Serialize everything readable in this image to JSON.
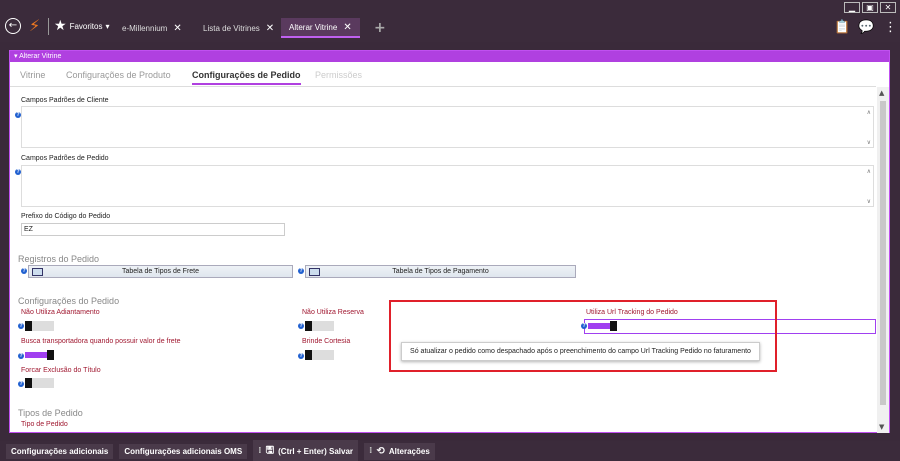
{
  "window": {
    "controls": [
      "▁",
      "▣",
      "✕"
    ]
  },
  "header": {
    "favorites_label": "Favoritos",
    "favorites_caret": "▾",
    "tabs": [
      {
        "label": "e-Millennium",
        "active": false
      },
      {
        "label": "Lista de Vitrines",
        "active": false
      },
      {
        "label": "Alterar Vitrine",
        "active": true
      }
    ],
    "close_glyph": "✕",
    "add_tab_glyph": "+"
  },
  "panel": {
    "title": "Alterar Vitrine",
    "subtabs": [
      {
        "label": "Vitrine",
        "state": "normal"
      },
      {
        "label": "Configurações de Produto",
        "state": "normal"
      },
      {
        "label": "Configurações de Pedido",
        "state": "active"
      },
      {
        "label": "Permissões",
        "state": "disabled"
      }
    ]
  },
  "form": {
    "campos_cliente_label": "Campos Padrões de Cliente",
    "campos_pedido_label": "Campos Padrões de Pedido",
    "prefixo_label": "Prefixo do Código do Pedido",
    "prefixo_value": "EZ",
    "registros_section": "Registros do Pedido",
    "tabela_frete": "Tabela de Tipos de Frete",
    "tabela_pagamento": "Tabela de Tipos de Pagamento",
    "config_section": "Configurações do Pedido",
    "nao_utiliza_adiantamento": "Não Utiliza Adiantamento",
    "nao_utiliza_reserva": "Não Utiliza Reserva",
    "utiliza_url_tracking": "Utiliza Url Tracking do Pedido",
    "busca_transportadora": "Busca transportadora quando possuir valor de frete",
    "brinde_cortesia": "Brinde Cortesia",
    "forcar_exclusao": "Forcar Exclusão do Título",
    "tipos_section": "Tipos de Pedido",
    "tipo_pedido_label": "Tipo de Pedido",
    "tooltip": "Só atualizar o pedido como despachado após o preenchimento do campo Url Tracking Pedido no faturamento",
    "toggles": {
      "nao_utiliza_adiantamento": 0,
      "nao_utiliza_reserva": 0,
      "utiliza_url_tracking": 1,
      "busca_transportadora": 1,
      "brinde_cortesia": 0,
      "forcar_exclusao": 0
    }
  },
  "bottom": {
    "btn_config_adicionais": "Configurações adicionais",
    "btn_config_oms": "Configurações adicionais OMS",
    "btn_salvar": "(Ctrl + Enter) Salvar",
    "btn_alteracoes": "Alterações"
  },
  "colors": {
    "accent": "#b040e0",
    "highlight_box": "#e0202a",
    "label_red": "#a01830",
    "chrome": "#3b2b3b"
  },
  "icons": [
    "back-icon",
    "logo-icon",
    "star-icon",
    "plus-icon",
    "clipboard-icon",
    "chat-icon",
    "more-icon",
    "help-icon",
    "table-icon",
    "save-icon",
    "history-icon"
  ]
}
